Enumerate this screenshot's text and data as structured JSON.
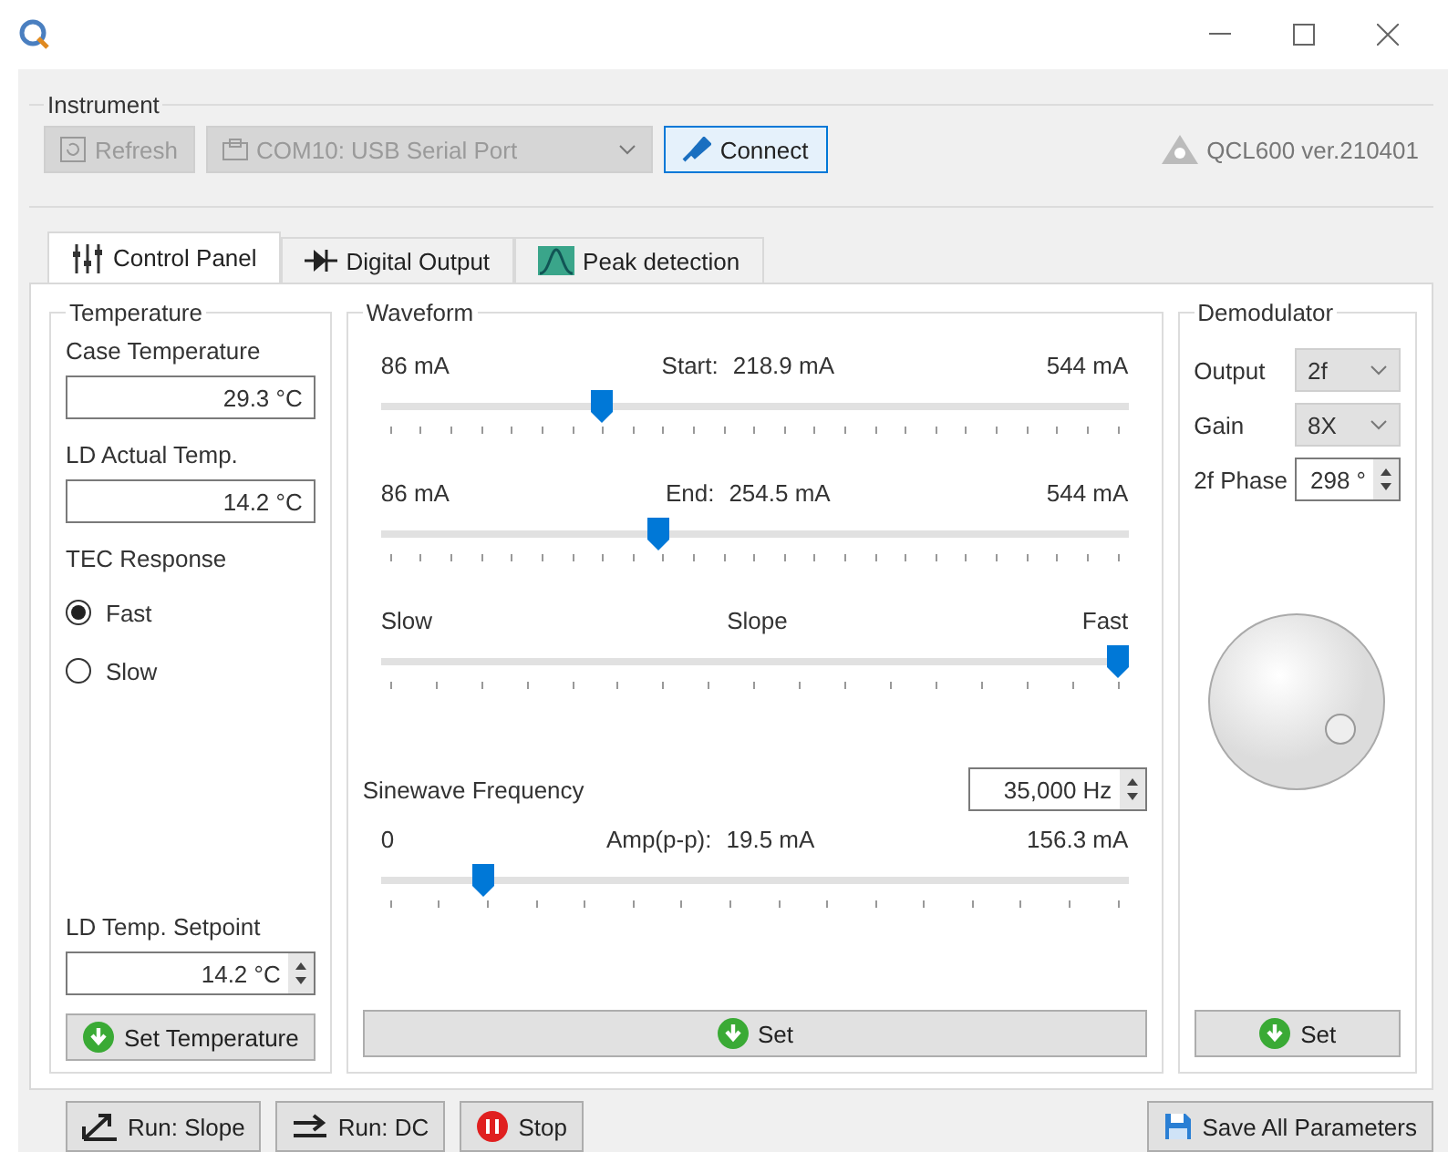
{
  "instrument": {
    "title": "Instrument",
    "refresh": {
      "label": "Refresh",
      "disabled": true
    },
    "port": {
      "value": "COM10: USB Serial Port",
      "disabled": true
    },
    "connect": {
      "label": "Connect"
    },
    "version": "QCL600 ver.210401"
  },
  "tabs": [
    {
      "label": "Control Panel",
      "selected": true,
      "kind": "sliders"
    },
    {
      "label": "Digital Output",
      "selected": false,
      "kind": "diode"
    },
    {
      "label": "Peak detection",
      "selected": false,
      "kind": "peak"
    }
  ],
  "temperature": {
    "title": "Temperature",
    "fields": [
      {
        "label": "Case Temperature",
        "value": "29.3 °C"
      },
      {
        "label": "LD Actual Temp.",
        "value": "14.2 °C"
      }
    ],
    "response_label": "TEC Response",
    "response_options": [
      {
        "label": "Fast",
        "selected": true
      },
      {
        "label": "Slow",
        "selected": false
      }
    ],
    "setpoint": {
      "label": "LD Temp. Setpoint",
      "value": "14.2 °C"
    },
    "button": "Set Temperature"
  },
  "waveform": {
    "title": "Waveform",
    "sliders": [
      {
        "min": "86 mA",
        "label": "Start:",
        "reading": "218.9 mA",
        "max": "544 mA",
        "level": 0.29
      },
      {
        "min": "86 mA",
        "label": "End:",
        "reading": "254.5 mA",
        "max": "544 mA",
        "level": 0.368
      },
      {
        "min": "Slow",
        "label": "Slope",
        "max": "Fast",
        "level": 1
      }
    ],
    "frequency": {
      "label": "Sinewave Frequency",
      "value": "35,000 Hz"
    },
    "amplitude": {
      "min": "0",
      "label": "Amp(p-p):",
      "reading": "19.5 mA",
      "max": "156.3 mA",
      "level": 0.125
    },
    "button": "Set"
  },
  "demodulator": {
    "title": "Demodulator",
    "output": {
      "label": "Output",
      "value": "2f"
    },
    "gain": {
      "label": "Gain",
      "value": "8X"
    },
    "phase": {
      "label": "2f Phase",
      "value": "298 °"
    },
    "button": "Set"
  },
  "footer": {
    "buttons": [
      {
        "label": "Run: Slope",
        "kind": "slope"
      },
      {
        "label": "Run: DC",
        "kind": "dc"
      },
      {
        "label": "Stop",
        "kind": "stop"
      }
    ],
    "save": "Save All Parameters"
  }
}
